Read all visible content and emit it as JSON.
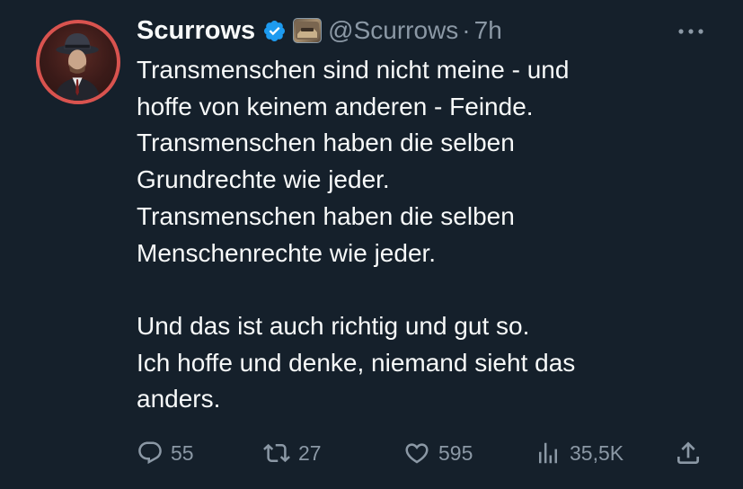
{
  "author": {
    "name": "Scurrows",
    "handle": "@Scurrows",
    "separator": "·",
    "time": "7h"
  },
  "tweet": {
    "lines": [
      "Transmenschen sind nicht meine - und",
      "hoffe von keinem anderen - Feinde.",
      "Transmenschen haben die selben",
      "Grundrechte wie jeder.",
      "Transmenschen haben die selben",
      "Menschenrechte wie jeder.",
      "",
      "Und das ist auch richtig und gut so.",
      "Ich hoffe und denke, niemand sieht das",
      "anders."
    ]
  },
  "actions": {
    "replies": "55",
    "retweets": "27",
    "likes": "595",
    "views": "35,5K"
  },
  "icons": {
    "verified": "verified-badge-icon",
    "more": "more-horizontal-icon",
    "reply": "reply-icon",
    "retweet": "retweet-icon",
    "like": "heart-icon",
    "views": "views-icon",
    "share": "share-icon"
  },
  "colors": {
    "background": "#15202b",
    "text": "#f7f9f9",
    "secondary": "#8b98a5",
    "verified": "#1d9bf0",
    "avatar_ring": "#d9534f"
  }
}
